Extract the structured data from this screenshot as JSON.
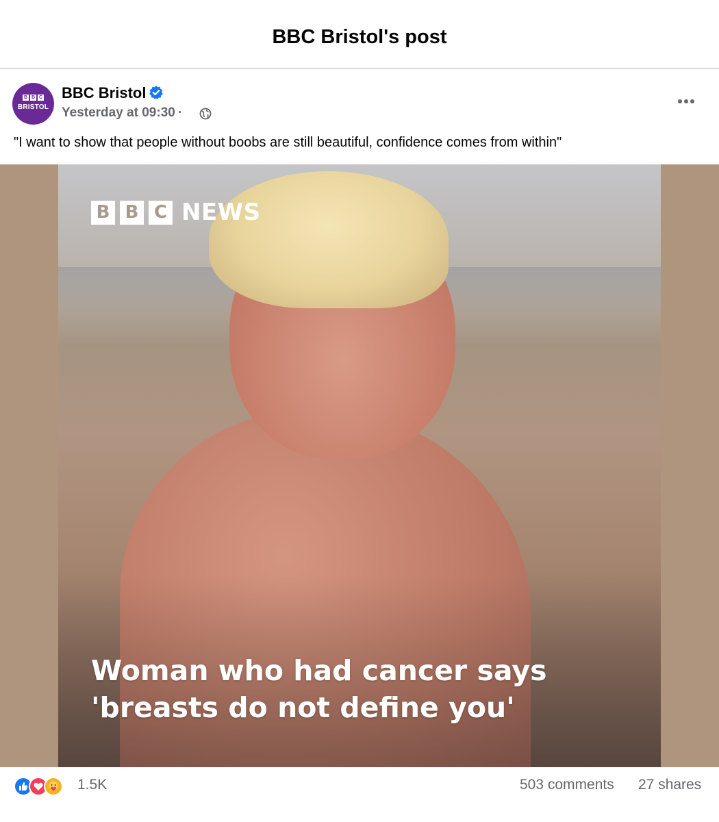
{
  "header": {
    "title": "BBC Bristol's post"
  },
  "post": {
    "page_name": "BBC Bristol",
    "avatar": {
      "blocks": [
        "B",
        "B",
        "C"
      ],
      "label": "BRISTOL",
      "color": "#6a2a95"
    },
    "timestamp": "Yesterday at 09:30",
    "separator": "·",
    "audience_icon": "globe-icon",
    "verified_icon": "verified-badge-icon",
    "caption": "\"I want to show that people without boobs are still beautiful, confidence comes from within\""
  },
  "media": {
    "logo": {
      "blocks": [
        "B",
        "B",
        "C"
      ],
      "word": "NEWS"
    },
    "headline_line1": "Woman who had cancer says",
    "headline_line2": "'breasts do not define you'",
    "description": "photo-of-person-on-beach"
  },
  "stats": {
    "reaction_icons": [
      "like-icon",
      "love-icon",
      "care-icon"
    ],
    "reaction_count": "1.5K",
    "comments": "503 comments",
    "shares": "27 shares"
  },
  "colors": {
    "accent": "#1877f2",
    "brand": "#6a2a95",
    "secondary_text": "#65676b"
  }
}
